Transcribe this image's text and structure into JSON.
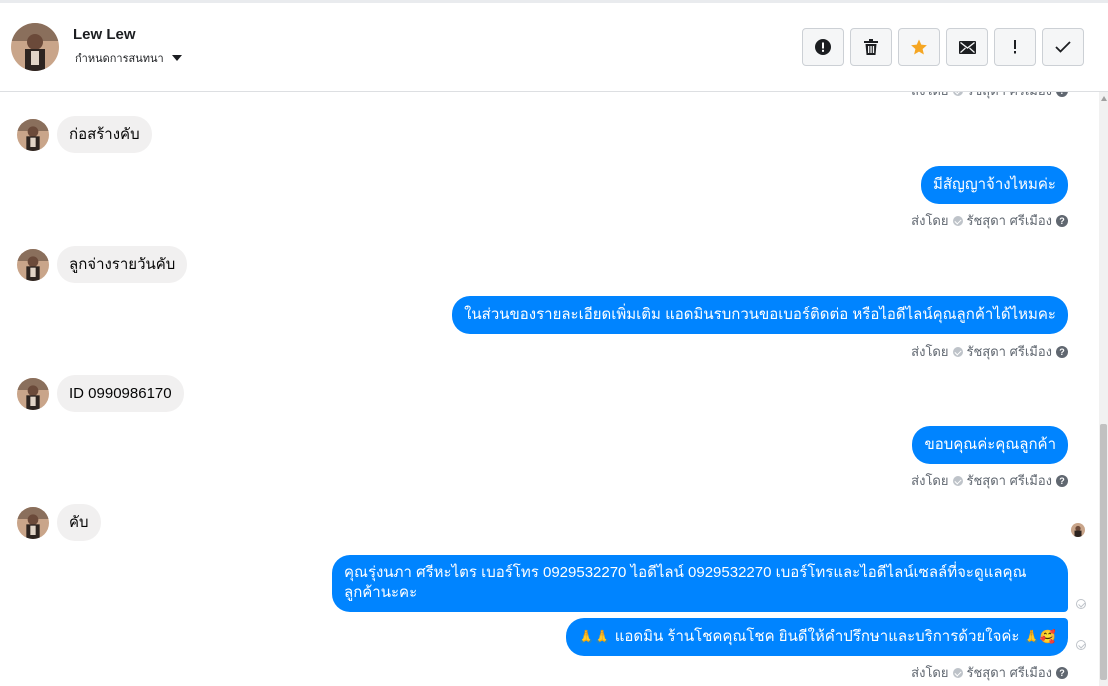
{
  "header": {
    "name": "Lew Lew",
    "subtitle": "กำหนดการสนทนา",
    "actions": [
      {
        "name": "report",
        "icon": "exclamation-circle-icon",
        "color": "#1c1e21"
      },
      {
        "name": "delete",
        "icon": "trash-icon",
        "color": "#1c1e21"
      },
      {
        "name": "star",
        "icon": "star-icon",
        "color": "#f5a623"
      },
      {
        "name": "mark-unread",
        "icon": "envelope-icon",
        "color": "#1c1e21"
      },
      {
        "name": "flag",
        "icon": "exclamation-icon",
        "color": "#1c1e21"
      },
      {
        "name": "done",
        "icon": "check-icon",
        "color": "#1c1e21"
      }
    ]
  },
  "meta": {
    "sent_by_label": "ส่งโดย",
    "sender": "รัชสุดา ศรีเมือง",
    "top_clipped": "ส่งโดย ⊘ รัชสุดา ศรีเมือง"
  },
  "messages": {
    "m1": "ก่อสร้างคับ",
    "m2": "มีสัญญาจ้างไหมค่ะ",
    "m3": "ลูกจ่างรายวันคับ",
    "m4": "ในส่วนของรายละเอียดเพิ่มเติม แอดมินรบกวนขอเบอร์ติดต่อ หรือไอดีไลน์คุณลูกค้าได้ไหมคะ",
    "m5": "ID 0990986170",
    "m6": "ขอบคุณค่ะคุณลูกค้า",
    "m7": "คับ",
    "m8": "คุณรุ่งนภา ศรีหะไตร       เบอร์โทร 0929532270  ไอดีไลน์ 0929532270    เบอร์โทรและไอดีไลน์เซลล์ที่จะดูแลคุณลูกค้านะคะ",
    "m9_prefix": "🙏🙏",
    "m9": "แอดมิน ร้านโชคคุณโชค ยินดีให้คำปรึกษาและบริการด้วยใจค่ะ",
    "m9_suffix": "🙏🥰"
  },
  "colors": {
    "outgoing_bubble": "#0084ff",
    "incoming_bubble": "#f1f0f0",
    "star": "#f5a623"
  }
}
